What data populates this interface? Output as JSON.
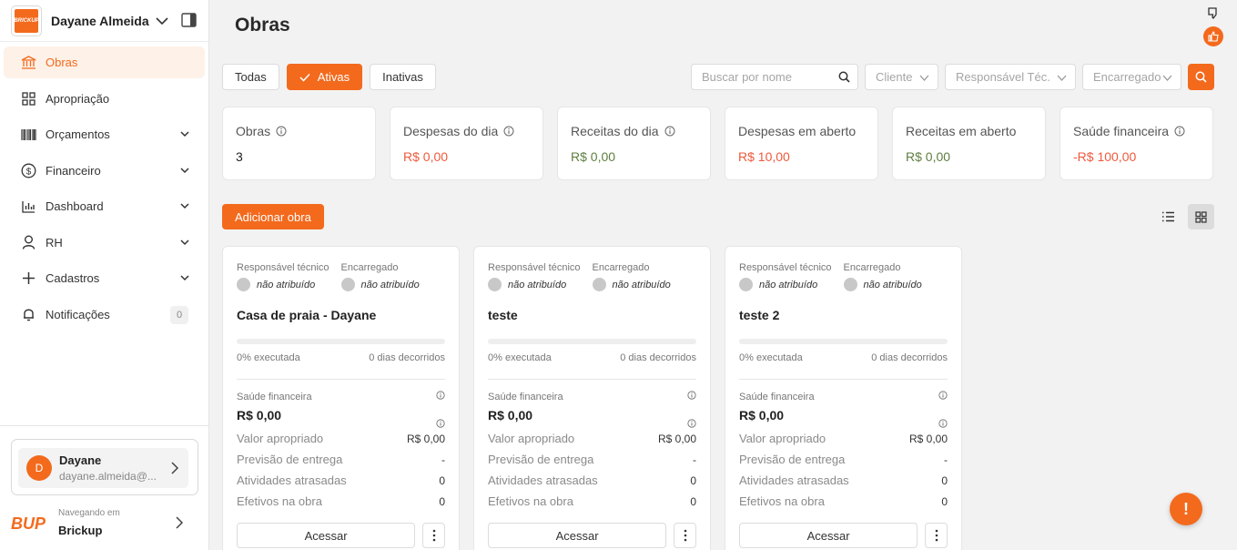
{
  "sidebar": {
    "org_name": "Dayane Almeida",
    "logo_text": "BRICKUP",
    "items": [
      {
        "label": "Obras",
        "icon": "bank-icon",
        "active": true
      },
      {
        "label": "Apropriação",
        "icon": "grid-icon"
      },
      {
        "label": "Orçamentos",
        "icon": "barcode-icon"
      },
      {
        "label": "Financeiro",
        "icon": "dollar-icon"
      },
      {
        "label": "Dashboard",
        "icon": "bar-chart-icon"
      },
      {
        "label": "RH",
        "icon": "person-icon"
      },
      {
        "label": "Cadastros",
        "icon": "plus-icon"
      },
      {
        "label": "Notificações",
        "icon": "bell-icon",
        "badge": "0"
      }
    ],
    "user": {
      "initial": "D",
      "name": "Dayane",
      "email": "dayane.almeida@..."
    },
    "navigating_label": "Navegando em",
    "navigating_org": "Brickup",
    "brand_text": "BUP"
  },
  "page": {
    "title": "Obras"
  },
  "filters": {
    "tabs": [
      "Todas",
      "Ativas",
      "Inativas"
    ],
    "search_placeholder": "Buscar por nome",
    "cliente": "Cliente",
    "responsavel": "Responsável Téc.",
    "encarregado": "Encarregado"
  },
  "stats": [
    {
      "title": "Obras",
      "value": "3",
      "info": true,
      "color": "#222222"
    },
    {
      "title": "Despesas do dia",
      "value": "R$ 0,00",
      "info": true,
      "color": "#ef5a3c"
    },
    {
      "title": "Receitas do dia",
      "value": "R$ 0,00",
      "info": true,
      "color": "#5e7e3f"
    },
    {
      "title": "Despesas em aberto",
      "value": "R$ 10,00",
      "info": false,
      "color": "#ef5a3c"
    },
    {
      "title": "Receitas em aberto",
      "value": "R$ 0,00",
      "info": false,
      "color": "#5e7e3f"
    },
    {
      "title": "Saúde financeira",
      "value": "-R$ 100,00",
      "info": true,
      "color": "#ef5a3c"
    }
  ],
  "actions": {
    "add_label": "Adicionar obra"
  },
  "card_labels": {
    "responsavel": "Responsável técnico",
    "encarregado": "Encarregado",
    "unassigned": "não atribuído",
    "saude": "Saúde financeira",
    "valor_apropriado": "Valor apropriado",
    "previsao": "Previsão de entrega",
    "atividades": "Atividades atrasadas",
    "efetivos": "Efetivos na obra",
    "acessar": "Acessar"
  },
  "obras": [
    {
      "name": "Casa de praia - Dayane",
      "progress": 0,
      "executada": "0% executada",
      "dias": "0 dias decorridos",
      "saude": "R$ 0,00",
      "valor_apropriado": "R$ 0,00",
      "previsao": "-",
      "atividades": "0",
      "efetivos": "0"
    },
    {
      "name": "teste",
      "progress": 0,
      "executada": "0% executada",
      "dias": "0 dias decorridos",
      "saude": "R$ 0,00",
      "valor_apropriado": "R$ 0,00",
      "previsao": "-",
      "atividades": "0",
      "efetivos": "0"
    },
    {
      "name": "teste 2",
      "progress": 0,
      "executada": "0% executada",
      "dias": "0 dias decorridos",
      "saude": "R$ 0,00",
      "valor_apropriado": "R$ 0,00",
      "previsao": "-",
      "atividades": "0",
      "efetivos": "0"
    }
  ],
  "fab_label": "!",
  "colors": {
    "accent": "#f36a1d",
    "negative": "#ef5a3c",
    "positive": "#5e7e3f"
  }
}
